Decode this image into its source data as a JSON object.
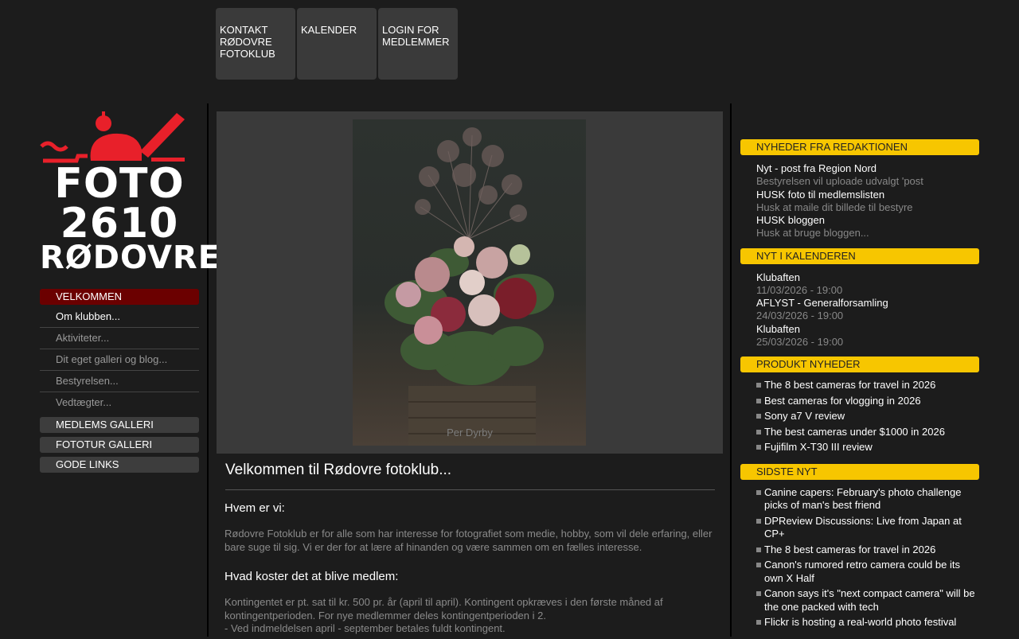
{
  "topnav": [
    {
      "label": "KONTAKT RØDOVRE FOTOKLUB"
    },
    {
      "label": "KALENDER"
    },
    {
      "label": "LOGIN FOR MEDLEMMER"
    }
  ],
  "logo": {
    "line1": "FOTO",
    "line2": "2610",
    "line3": "RØDOVRE"
  },
  "leftmenu": {
    "velkommen": "VELKOMMEN",
    "subs": [
      "Om klubben...",
      "Aktiviteter...",
      "Dit eget galleri og blog...",
      "Bestyrelsen...",
      "Vedtægter..."
    ],
    "medlems": "MEDLEMS GALLERI",
    "fototur": "FOTOTUR GALLERI",
    "links": "GODE LINKS"
  },
  "hero": {
    "credit": "Per Dyrby"
  },
  "content": {
    "title": "Velkommen til Rødovre fotoklub...",
    "h_hvem": "Hvem er vi:",
    "p_hvem": "Rødovre Fotoklub er for alle som har interesse for fotografiet som medie, hobby, som vil dele erfaring, eller bare suge til sig. Vi er der for at lære af hinanden og være sammen om en fælles interesse.",
    "h_pris": "Hvad koster det at blive medlem:",
    "p_pris1": "Kontingentet er pt. sat til kr. 500 pr. år (april til april). Kontingent opkræves i den første måned af kontingentperioden. For nye medlemmer deles kontingentperioden i 2.",
    "p_pris2": "- Ved indmeldelsen april - september betales fuldt kontingent."
  },
  "right": {
    "news_head": "NYHEDER FRA REDAKTIONEN",
    "news": [
      {
        "title": "Nyt - post fra Region Nord",
        "sub": "Bestyrelsen vil uploade udvalgt 'post"
      },
      {
        "title": "HUSK foto til medlemslisten",
        "sub": "Husk at maile dit billede til bestyre"
      },
      {
        "title": "HUSK bloggen",
        "sub": "Husk at bruge bloggen..."
      }
    ],
    "cal_head": "NYT I KALENDEREN",
    "cal": [
      {
        "title": "Klubaften",
        "sub": "11/03/2026 - 19:00"
      },
      {
        "title": "AFLYST - Generalforsamling",
        "sub": "24/03/2026 - 19:00"
      },
      {
        "title": "Klubaften",
        "sub": "25/03/2026 - 19:00"
      }
    ],
    "prod_head": "PRODUKT NYHEDER",
    "prod": [
      "The 8 best cameras for travel in 2026",
      "Best cameras for vlogging in 2026",
      "Sony a7 V review",
      "The best cameras under $1000 in 2026",
      "Fujifilm X-T30 III review"
    ],
    "last_head": "SIDSTE NYT",
    "last": [
      "Canine capers: February's photo challenge picks of man's best friend",
      "DPReview Discussions: Live from Japan at CP+",
      "The 8 best cameras for travel in 2026",
      "Canon's rumored retro camera could be its own X Half",
      "Canon says it's \"next compact camera\" will be the one packed with tech",
      "Flickr is hosting a real-world photo festival"
    ]
  },
  "colors": {
    "accent_yellow": "#f7c600",
    "active_red": "#6b0000",
    "logo_red": "#e8202a"
  }
}
